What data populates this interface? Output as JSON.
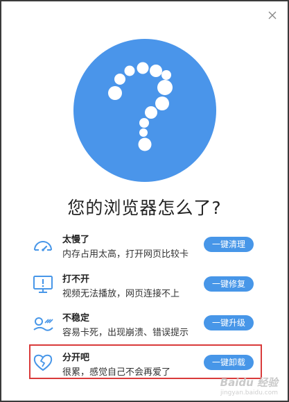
{
  "dialog": {
    "close_icon": "close-icon",
    "hero_icon": "question-mark-icon",
    "title": "您的浏览器怎么了?"
  },
  "colors": {
    "accent": "#4796e8",
    "hero": "#4a95ea",
    "highlight": "#d93a3a"
  },
  "rows": [
    {
      "icon": "speedometer-icon",
      "name": "太慢了",
      "desc": "内存占用太高，打开网页比较卡",
      "action": "一键清理"
    },
    {
      "icon": "monitor-alert-icon",
      "name": "打不开",
      "desc": "视频无法播放，网页连接不上",
      "action": "一键修复"
    },
    {
      "icon": "unstable-icon",
      "name": "不稳定",
      "desc": "容易卡死，出现崩溃、错误提示",
      "action": "一键升级"
    },
    {
      "icon": "broken-heart-icon",
      "name": "分开吧",
      "desc": "很累，感觉自己不会再爱了",
      "action": "一键卸载"
    }
  ],
  "watermark": {
    "text": "Baidu 经验",
    "sub": "jingyan.baidu.com"
  }
}
